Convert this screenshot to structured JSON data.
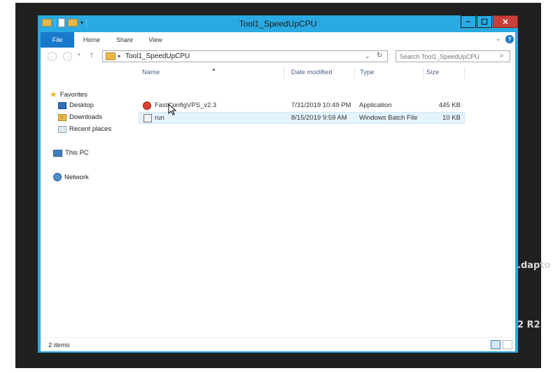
{
  "window": {
    "title": "Tool1_SpeedUpCPU",
    "controls": {
      "minimize": "–",
      "maximize": "☐",
      "close": "✕"
    }
  },
  "ribbon": {
    "tabs": [
      {
        "label": "File",
        "active": true
      },
      {
        "label": "Home"
      },
      {
        "label": "Share"
      },
      {
        "label": "View"
      }
    ],
    "help": "?"
  },
  "nav": {
    "back": "←",
    "forward": "→",
    "up": "↑",
    "address": "Tool1_SpeedUpCPU",
    "search_placeholder": "Search Tool1_SpeedUpCPU"
  },
  "sidebar": {
    "items": [
      {
        "label": "Favorites",
        "icon": "star-icon"
      },
      {
        "label": "Desktop",
        "icon": "desktop-icon"
      },
      {
        "label": "Downloads",
        "icon": "downloads-icon"
      },
      {
        "label": "Recent places",
        "icon": "recent-places-icon"
      },
      {
        "label": "This PC",
        "icon": "computer-icon"
      },
      {
        "label": "Network",
        "icon": "network-icon"
      }
    ]
  },
  "filelist": {
    "columns": [
      "Name",
      "Date modified",
      "Type",
      "Size"
    ],
    "files": [
      {
        "name": "FastConfigVPS_v2.3",
        "date": "7/31/2019 10:49 PM",
        "type": "Application",
        "size": "445 KB",
        "icon": "application-icon"
      },
      {
        "name": "run",
        "date": "8/15/2019 9:59 AM",
        "type": "Windows Batch File",
        "size": "10 KB",
        "icon": "batch-file-icon"
      }
    ]
  },
  "status": {
    "count": "2 items"
  },
  "backdrop": {
    "text1": ".dapto",
    "text2": "2 R2"
  },
  "colors": {
    "accent": "#2aaae2",
    "file_tab": "#1979ca",
    "close": "#c7403a",
    "header": "#4d6185"
  }
}
